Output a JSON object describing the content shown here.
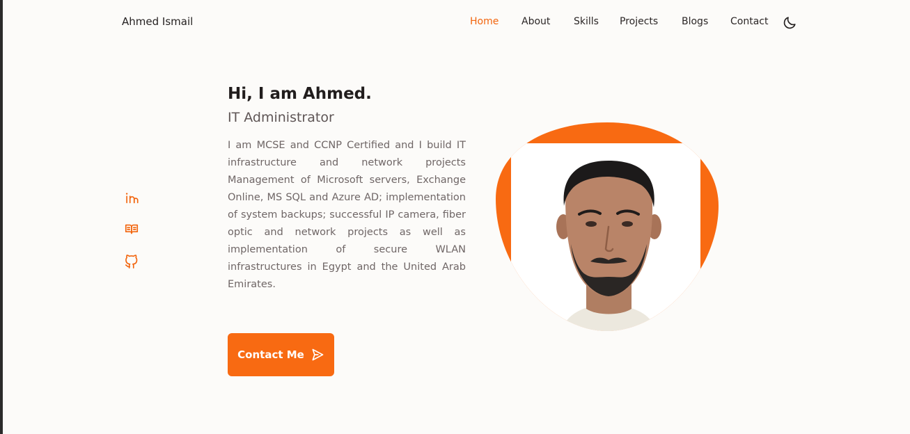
{
  "header": {
    "logo_text": "Ahmed Ismail",
    "nav": [
      {
        "label": "Home",
        "active": true
      },
      {
        "label": "About",
        "active": false
      },
      {
        "label": "Skills",
        "active": false
      },
      {
        "label": "Projects",
        "active": false
      },
      {
        "label": "Blogs",
        "active": false
      },
      {
        "label": "Contact",
        "active": false
      }
    ],
    "theme_toggle_icon": "moon-icon"
  },
  "socials": [
    {
      "icon": "linkedin-icon"
    },
    {
      "icon": "book-icon"
    },
    {
      "icon": "github-icon"
    }
  ],
  "hero": {
    "title": "Hi, I am Ahmed.",
    "subtitle": "IT Administrator",
    "description": "I am MCSE and CCNP Certified and I build IT infrastructure and network projects Management of Microsoft servers, Exchange Online, MS SQL and Azure AD; implementation of system backups; successful IP camera, fiber optic and network projects as well as implementation of secure WLAN infrastructures in Egypt and the United Arab Emirates.",
    "cta_label": "Contact Me",
    "cta_icon": "send-icon",
    "profile_image": "profile-photo"
  },
  "colors": {
    "accent": "#f86a12",
    "background": "#fcfbf9",
    "text": "#2b2626",
    "muted": "#6f6666"
  }
}
